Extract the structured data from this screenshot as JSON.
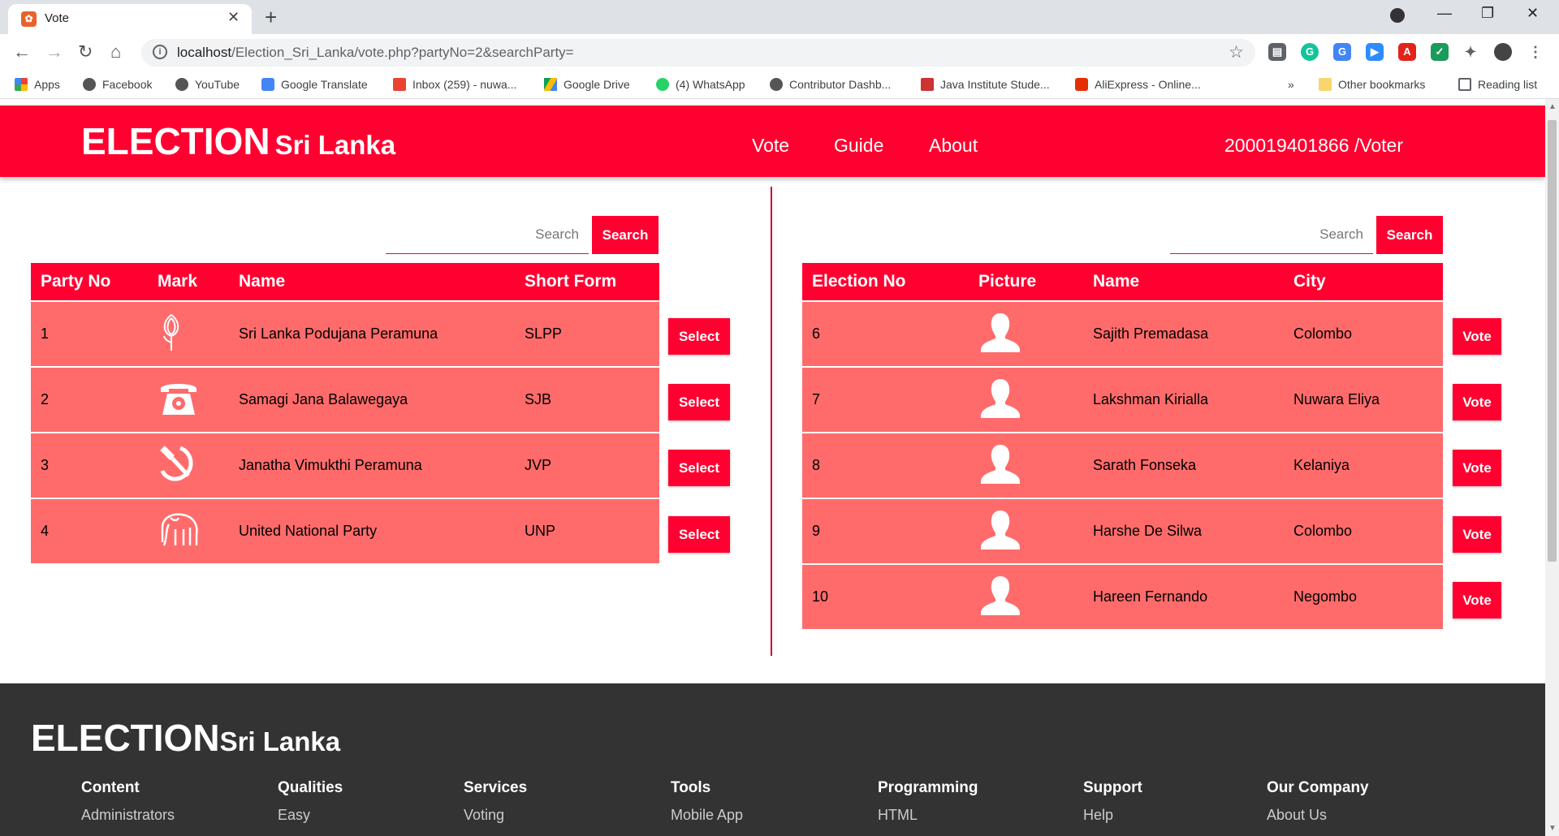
{
  "browser": {
    "tab_title": "Vote",
    "url_host": "localhost",
    "url_path": "/Election_Sri_Lanka/vote.php?partyNo=2&searchParty=",
    "bookmarks": [
      "Apps",
      "Facebook",
      "YouTube",
      "Google Translate",
      "Inbox (259) - nuwa...",
      "Google Drive",
      "(4) WhatsApp",
      "Contributor Dashb...",
      "Java Institute Stude...",
      "AliExpress - Online...",
      "»",
      "Other bookmarks",
      "Reading list"
    ]
  },
  "header": {
    "brand_big": "ELECTION",
    "brand_small": "Sri Lanka",
    "nav": [
      "Vote",
      "Guide",
      "About"
    ],
    "user": "200019401866 /Voter"
  },
  "party_panel": {
    "search_placeholder": "Search",
    "search_button": "Search",
    "columns": [
      "Party No",
      "Mark",
      "Name",
      "Short Form"
    ],
    "rows": [
      {
        "no": "1",
        "mark": "lotus-bud-icon",
        "name": "Sri Lanka Podujana Peramuna",
        "short": "SLPP",
        "action": "Select"
      },
      {
        "no": "2",
        "mark": "telephone-icon",
        "name": "Samagi Jana Balawegaya",
        "short": "SJB",
        "action": "Select"
      },
      {
        "no": "3",
        "mark": "hammer-sickle-icon",
        "name": "Janatha Vimukthi Peramuna",
        "short": "JVP",
        "action": "Select"
      },
      {
        "no": "4",
        "mark": "elephant-icon",
        "name": "United National Party",
        "short": "UNP",
        "action": "Select"
      }
    ]
  },
  "candidate_panel": {
    "search_placeholder": "Search",
    "search_button": "Search",
    "columns": [
      "Election No",
      "Picture",
      "Name",
      "City"
    ],
    "rows": [
      {
        "no": "6",
        "name": "Sajith Premadasa",
        "city": "Colombo",
        "action": "Vote"
      },
      {
        "no": "7",
        "name": "Lakshman Kirialla",
        "city": "Nuwara Eliya",
        "action": "Vote"
      },
      {
        "no": "8",
        "name": "Sarath Fonseka",
        "city": "Kelaniya",
        "action": "Vote"
      },
      {
        "no": "9",
        "name": "Harshe De Silwa",
        "city": "Colombo",
        "action": "Vote"
      },
      {
        "no": "10",
        "name": "Hareen Fernando",
        "city": "Negombo",
        "action": "Vote"
      }
    ]
  },
  "footer": {
    "brand_big": "ELECTION",
    "brand_small": "Sri Lanka",
    "columns": [
      {
        "head": "Content",
        "link": "Administrators"
      },
      {
        "head": "Qualities",
        "link": "Easy"
      },
      {
        "head": "Services",
        "link": "Voting"
      },
      {
        "head": "Tools",
        "link": "Mobile App"
      },
      {
        "head": "Programming",
        "link": "HTML"
      },
      {
        "head": "Support",
        "link": "Help"
      },
      {
        "head": "Our Company",
        "link": "About Us"
      }
    ]
  },
  "colors": {
    "primary": "#ff0030",
    "row": "#ff6b6b",
    "footer": "#333333"
  }
}
